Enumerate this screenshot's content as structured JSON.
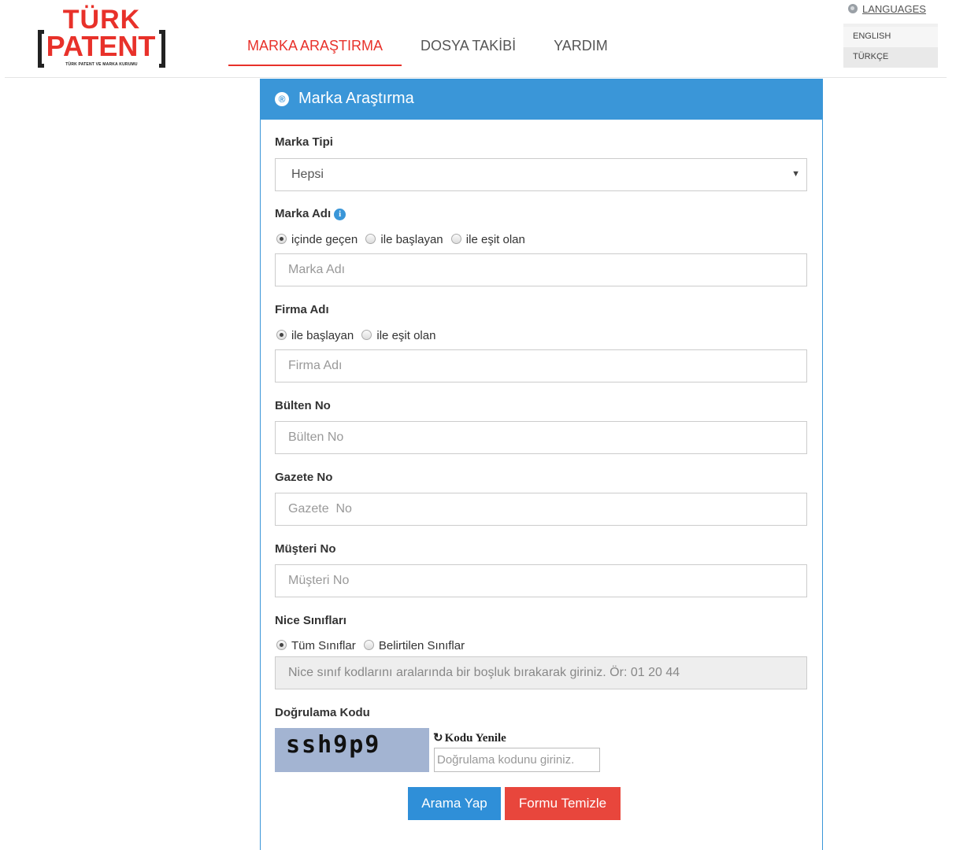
{
  "logo": {
    "top": "TÜRK",
    "main": "PATENT",
    "subtitle": "TÜRK PATENT VE MARKA KURUMU"
  },
  "nav": {
    "items": [
      {
        "label": "MARKA ARAŞTIRMA",
        "active": true
      },
      {
        "label": "DOSYA TAKİBİ"
      },
      {
        "label": "YARDIM"
      }
    ]
  },
  "languages": {
    "title": "LANGUAGES",
    "options": [
      "ENGLISH",
      "TÜRKÇE"
    ],
    "selected": "TÜRKÇE"
  },
  "panel": {
    "title": "Marka Araştırma",
    "icon": "registered-icon"
  },
  "form": {
    "marka_tipi": {
      "label": "Marka Tipi",
      "value": "Hepsi"
    },
    "marka_adi": {
      "label": "Marka Adı",
      "placeholder": "Marka Adı",
      "options": [
        "içinde geçen",
        "ile başlayan",
        "ile eşit olan"
      ],
      "selected": 0
    },
    "firma_adi": {
      "label": "Firma Adı",
      "placeholder": "Firma Adı",
      "options": [
        "ile başlayan",
        "ile eşit olan"
      ],
      "selected": 0
    },
    "bulten_no": {
      "label": "Bülten No",
      "placeholder": "Bülten No"
    },
    "gazete_no": {
      "label": "Gazete No",
      "placeholder": "Gazete  No"
    },
    "musteri_no": {
      "label": "Müşteri No",
      "placeholder": "Müşteri No"
    },
    "nice": {
      "label": "Nice Sınıfları",
      "options": [
        "Tüm Sınıflar",
        "Belirtilen Sınıflar"
      ],
      "selected": 0,
      "placeholder": "Nice sınıf kodlarını aralarında bir boşluk bırakarak giriniz. Ör: 01 20 44"
    },
    "captcha": {
      "label": "Doğrulama Kodu",
      "image_text": "ssh9p9",
      "refresh": "Kodu Yenile",
      "placeholder": "Doğrulama kodunu giriniz."
    }
  },
  "buttons": {
    "search": "Arama Yap",
    "clear": "Formu Temizle"
  }
}
